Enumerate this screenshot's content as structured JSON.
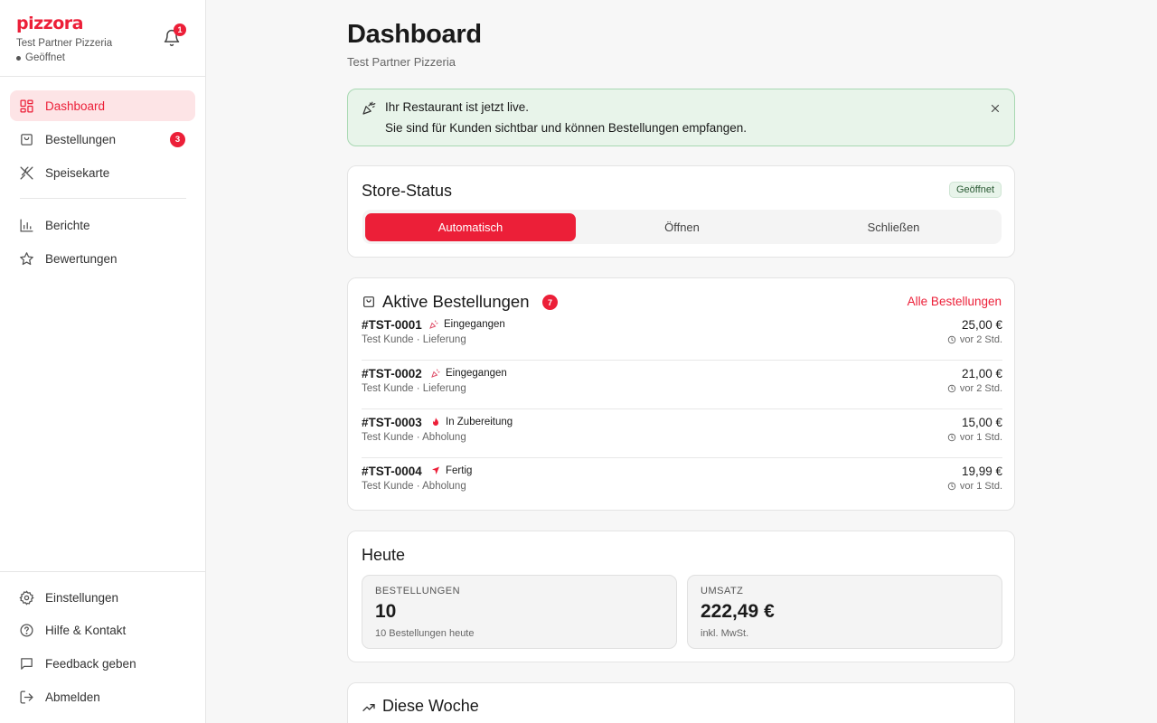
{
  "sidebar": {
    "logo": "pizzora",
    "partner": "Test Partner Pizzeria",
    "status": "Geöffnet",
    "notifications": "1",
    "nav": [
      {
        "label": "Dashboard",
        "icon": "grid-icon",
        "active": true
      },
      {
        "label": "Bestellungen",
        "icon": "shopping-bag-icon",
        "badge": "3"
      },
      {
        "label": "Speisekarte",
        "icon": "utensils-icon"
      },
      {
        "label": "Berichte",
        "icon": "bar-chart-icon"
      },
      {
        "label": "Bewertungen",
        "icon": "star-icon"
      }
    ],
    "footer_nav": [
      {
        "label": "Einstellungen",
        "icon": "gear-icon"
      },
      {
        "label": "Hilfe & Kontakt",
        "icon": "help-circle-icon"
      },
      {
        "label": "Feedback geben",
        "icon": "message-icon"
      },
      {
        "label": "Abmelden",
        "icon": "logout-icon"
      }
    ]
  },
  "header": {
    "title": "Dashboard",
    "subtitle": "Test Partner Pizzeria"
  },
  "banner": {
    "title": "Ihr Restaurant ist jetzt live.",
    "text": "Sie sind für Kunden sichtbar und können Bestellungen empfangen."
  },
  "store_status": {
    "title": "Store-Status",
    "badge": "Geöffnet",
    "options": [
      "Automatisch",
      "Öffnen",
      "Schließen"
    ],
    "selected": "Automatisch"
  },
  "active_orders": {
    "title": "Aktive Bestellungen",
    "count": "7",
    "link": "Alle Bestellungen",
    "orders": [
      {
        "id": "#TST-0001",
        "status": "Eingegangen",
        "status_icon": "party-popper-icon",
        "meta": "Test Kunde · Lieferung",
        "price": "25,00 €",
        "time": "vor 2 Std."
      },
      {
        "id": "#TST-0002",
        "status": "Eingegangen",
        "status_icon": "party-popper-icon",
        "meta": "Test Kunde · Lieferung",
        "price": "21,00 €",
        "time": "vor 2 Std."
      },
      {
        "id": "#TST-0003",
        "status": "In Zubereitung",
        "status_icon": "flame-icon",
        "meta": "Test Kunde · Abholung",
        "price": "15,00 €",
        "time": "vor 1 Std."
      },
      {
        "id": "#TST-0004",
        "status": "Fertig",
        "status_icon": "flag-icon",
        "meta": "Test Kunde · Abholung",
        "price": "19,99 €",
        "time": "vor 1 Std."
      }
    ]
  },
  "today": {
    "title": "Heute",
    "orders_label": "BESTELLUNGEN",
    "orders_value": "10",
    "orders_note": "10 Bestellungen heute",
    "revenue_label": "UMSATZ",
    "revenue_value": "222,49 €",
    "revenue_note": "inkl. MwSt."
  },
  "week": {
    "title": "Diese Woche"
  },
  "colors": {
    "accent": "#ec1f38",
    "success_bg": "#e8f4ea",
    "success_border": "#a8d8b2"
  }
}
